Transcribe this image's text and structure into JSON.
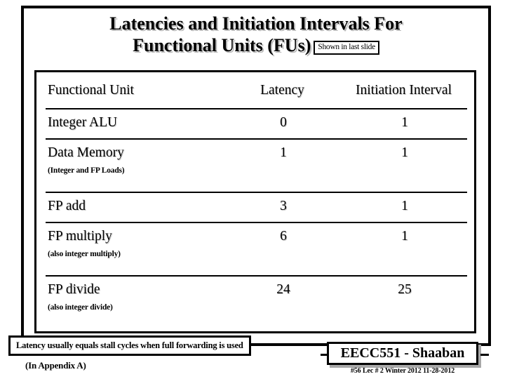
{
  "slide": {
    "title_line_1": "Latencies and Initiation Intervals For",
    "title_line_2": "Functional Units (FUs)",
    "callout_shown_last_slide": "Shown in last slide",
    "latency_note": "Latency usually equals stall cycles when  full forwarding is used",
    "appendix_note": "(In  Appendix A)"
  },
  "table": {
    "headers": {
      "unit": "Functional Unit",
      "latency": "Latency",
      "initiation_interval": "Initiation Interval"
    },
    "rows": [
      {
        "unit": "Integer ALU",
        "sub": "",
        "latency": "0",
        "initiation_interval": "1"
      },
      {
        "unit": "Data Memory",
        "sub": "(Integer and FP Loads)",
        "latency": "1",
        "initiation_interval": "1"
      },
      {
        "unit": "FP add",
        "sub": "",
        "latency": "3",
        "initiation_interval": "1"
      },
      {
        "unit": "FP multiply",
        "sub": "(also integer multiply)",
        "latency": "6",
        "initiation_interval": "1"
      },
      {
        "unit": "FP divide",
        "sub": "(also integer divide)",
        "latency": "24",
        "initiation_interval": "25"
      }
    ]
  },
  "footer": {
    "course_author": "EECC551 - Shaaban",
    "meta": "#56   Lec # 2   Winter 2012   11-28-2012"
  },
  "colors": {
    "ink": "#000000",
    "paper": "#ffffff",
    "text_shadow": "#b9b9b9",
    "box_shadow": "#a8a8a8"
  }
}
